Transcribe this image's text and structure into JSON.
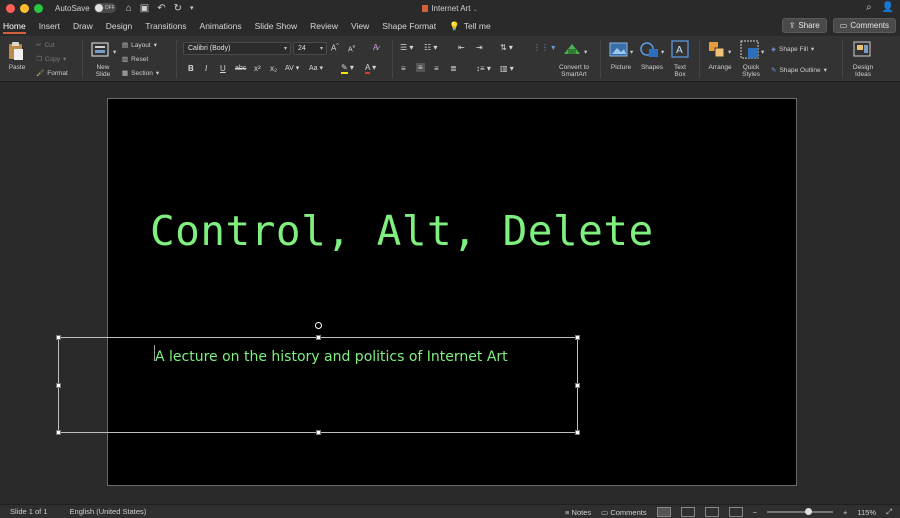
{
  "window": {
    "title": "Internet Art",
    "autosave_label": "AutoSave",
    "autosave_state": "OFF"
  },
  "tabs": [
    "Home",
    "Insert",
    "Draw",
    "Design",
    "Transitions",
    "Animations",
    "Slide Show",
    "Review",
    "View",
    "Shape Format"
  ],
  "tell_me": "Tell me",
  "share_label": "Share",
  "comments_label": "Comments",
  "ribbon": {
    "paste": "Paste",
    "cut": "Cut",
    "copy": "Copy",
    "format": "Format",
    "new_slide_l1": "New",
    "new_slide_l2": "Slide",
    "layout": "Layout",
    "reset": "Reset",
    "section": "Section",
    "font_name": "Calibri (Body)",
    "font_size": "24",
    "bold": "B",
    "italic": "I",
    "underline": "U",
    "strike": "abc",
    "superscript": "x²",
    "subscript": "x₂",
    "char_spacing": "AV",
    "change_case": "Aa",
    "convert_l1": "Convert to",
    "convert_l2": "SmartArt",
    "picture": "Picture",
    "shapes": "Shapes",
    "textbox_l1": "Text",
    "textbox_l2": "Box",
    "arrange": "Arrange",
    "quick_styles_l1": "Quick",
    "quick_styles_l2": "Styles",
    "shape_fill": "Shape Fill",
    "shape_outline": "Shape Outline",
    "design_ideas_l1": "Design",
    "design_ideas_l2": "Ideas"
  },
  "slide": {
    "title": "Control, Alt, Delete",
    "subtitle": "A lecture on the history and politics of Internet Art"
  },
  "status": {
    "slide_counter": "Slide 1 of 1",
    "language": "English (United States)",
    "notes": "Notes",
    "comments": "Comments",
    "zoom": "115%",
    "zoom_level": 0.62
  },
  "colors": {
    "slide_text": "#7ff07f",
    "active_tab_underline": "#d45f3c",
    "slide_background": "#000000"
  }
}
